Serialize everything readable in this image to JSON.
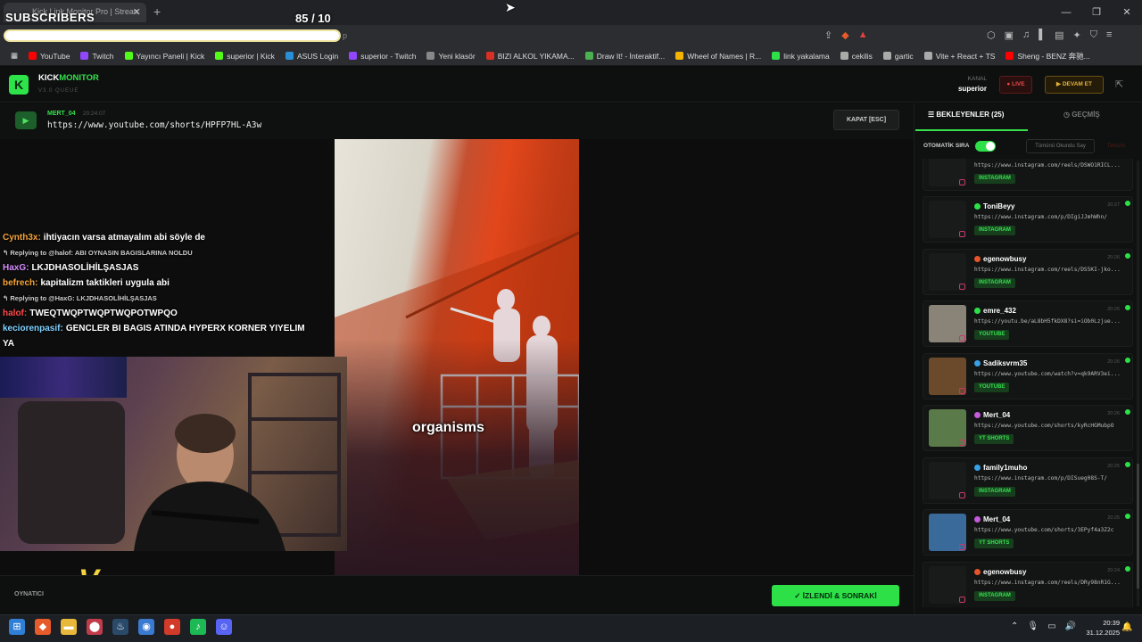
{
  "browser": {
    "tab_title": "Kick Link Monitor Pro | Strean",
    "tab_close": "✕",
    "new_tab": "+",
    "url_tail": "p",
    "window_controls": [
      "—",
      "❐",
      "✕"
    ],
    "bookmarks": [
      {
        "label": "YouTube",
        "color": "#ff0000"
      },
      {
        "label": "Twitch",
        "color": "#9146ff"
      },
      {
        "label": "Yayıncı Paneli | Kick",
        "color": "#53fc18"
      },
      {
        "label": "superior | Kick",
        "color": "#53fc18"
      },
      {
        "label": "ASUS Login",
        "color": "#2a8fd6"
      },
      {
        "label": "superior - Twitch",
        "color": "#9146ff"
      },
      {
        "label": "Yeni klasör",
        "color": "#888888"
      },
      {
        "label": "BIZI ALKOL YIKAMA...",
        "color": "#d93025"
      },
      {
        "label": "Draw It! - İnteraktif...",
        "color": "#4caf50"
      },
      {
        "label": "Wheel of Names | R...",
        "color": "#f4b400"
      },
      {
        "label": "link yakalama",
        "color": "#2ee24a"
      },
      {
        "label": "cekilis",
        "color": "#aaaaaa"
      },
      {
        "label": "gartic",
        "color": "#aaaaaa"
      },
      {
        "label": "Vite + React + TS",
        "color": "#aaaaaa"
      },
      {
        "label": "Sheng - BENZ 奔驰...",
        "color": "#ff0000"
      }
    ]
  },
  "overlay": {
    "subscribers_label": "SUBSCRIBERS",
    "subscribers_count": "85   / 10"
  },
  "app": {
    "brand_kick": "KICK",
    "brand_monitor": "MONITOR",
    "version": "V3.0 QUEUE",
    "logo_letter": "K",
    "channel_label": "KANAL",
    "channel_name": "superior",
    "live_label": "● LIVE",
    "continue_label": "▶  DEVAM ET"
  },
  "player": {
    "user": "MERT_04",
    "time": "20:24:07",
    "url": "https://www.youtube.com/shorts/HPFP7HL-A3w",
    "close_label": "KAPAT [ESC]",
    "caption": "organisms",
    "footer_label": "OYNATICI",
    "watched_next_label": "✓  İZLENDİ & SONRAKİ"
  },
  "chat": [
    {
      "user": "Cynth3x:",
      "color": "#f7a338",
      "text": "ihtiyacın varsa atmayalım abi söyle de"
    },
    {
      "reply": "↰ Replying to @halof: ABI OYNASIN BAGISLARINA NOLDU"
    },
    {
      "user": "HaxG:",
      "color": "#d68cff",
      "text": "LKJDHASOLİHİLŞASJAS"
    },
    {
      "user": "befrech:",
      "color": "#f7a338",
      "text": "kapitalizm taktikleri uygula abi"
    },
    {
      "reply": "↰ Replying to @HaxG: LKJDHASOLİHİLŞASJAS"
    },
    {
      "user": "halof:",
      "color": "#ff4b4b",
      "text": "TWEQTWQPTWQPTWQPOTWPQO"
    },
    {
      "user": "keciorenpasif:",
      "color": "#7fd0ff",
      "text": "GENCLER BI BAGIS ATINDA HYPERX KORNER YIYELIM"
    },
    {
      "cont": "YA"
    }
  ],
  "queue": {
    "tab_waiting": "☰  BEKLEYENLER (25)",
    "tab_history": "◷  GEÇMİŞ",
    "auto_label": "OTOMATİK SIRA",
    "mark_all_label": "Tümünü Okundu Say",
    "clear_label": "Temizle",
    "items": [
      {
        "user": "",
        "time": "",
        "url": "https://www.instagram.com/reels/DSWO1RICL...",
        "tag": "INSTAGRAM",
        "dot": "",
        "thumb": ""
      },
      {
        "user": "ToniBeyy",
        "time": "20:27",
        "url": "https://www.instagram.com/p/DIgiJJmhWhn/",
        "tag": "INSTAGRAM",
        "dot": "#2de048",
        "thumb": ""
      },
      {
        "user": "egenowbusy",
        "time": "20:26",
        "url": "https://www.instagram.com/reels/DS5KI-jko...",
        "tag": "INSTAGRAM",
        "dot": "#e5542b",
        "thumb": ""
      },
      {
        "user": "emre_432",
        "time": "20:26",
        "url": "https://youtu.be/aL8bH5fkDX8?si=iOb0Lzjue...",
        "tag": "YOUTUBE",
        "dot": "#2de048",
        "thumb": "#8a8478"
      },
      {
        "user": "Sadiksvrm35",
        "time": "20:26",
        "url": "https://www.youtube.com/watch?v=qk9ARV3ei...",
        "tag": "YOUTUBE",
        "dot": "#3aa0e6",
        "thumb": "#6a4a2a"
      },
      {
        "user": "Mert_04",
        "time": "20:26",
        "url": "https://www.youtube.com/shorts/kyRcHGMubpO",
        "tag": "YT SHORTS",
        "dot": "#c45adc",
        "thumb": "#5a7a4a"
      },
      {
        "user": "family1muho",
        "time": "20:25",
        "url": "https://www.instagram.com/p/DISueg08S-T/",
        "tag": "INSTAGRAM",
        "dot": "#3aa0e6",
        "thumb": ""
      },
      {
        "user": "Mert_04",
        "time": "20:25",
        "url": "https://www.youtube.com/shorts/3EPyf4a3Z2c",
        "tag": "YT SHORTS",
        "dot": "#c45adc",
        "thumb": "#3a6a9a"
      },
      {
        "user": "egenowbusy",
        "time": "20:24",
        "url": "https://www.instagram.com/reels/DRy98nR1G...",
        "tag": "INSTAGRAM",
        "dot": "#e5542b",
        "thumb": ""
      }
    ]
  },
  "taskbar": {
    "time": "20:39",
    "date": "31.12.2025",
    "icons": [
      "windows-icon",
      "brave-icon",
      "folder-icon",
      "maps-pin-icon",
      "steam-icon",
      "app-icon",
      "record-icon",
      "spotify-icon",
      "discord-icon"
    ]
  }
}
